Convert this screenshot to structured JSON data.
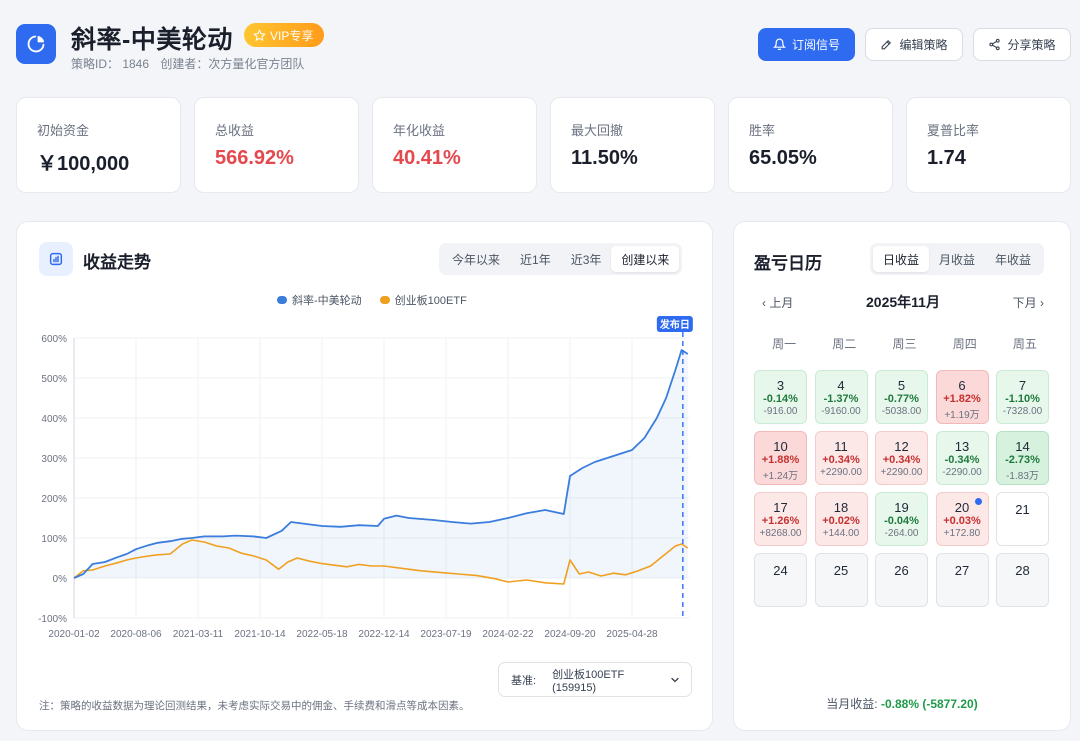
{
  "header": {
    "title": "斜率-中美轮动",
    "vip_label": "VIP专享",
    "strategy_id": "策略ID： 1846",
    "creator": "创建者：次方量化官方团队",
    "subscribe_label": "订阅信号",
    "edit_label": "编辑策略",
    "share_label": "分享策略"
  },
  "stats": [
    {
      "label": "初始资金",
      "value": "￥100,000",
      "color": "#1a1f2b"
    },
    {
      "label": "总收益",
      "value": "566.92%",
      "color": "#e5484d"
    },
    {
      "label": "年化收益",
      "value": "40.41%",
      "color": "#e5484d"
    },
    {
      "label": "最大回撤",
      "value": "11.50%",
      "color": "#1a1f2b"
    },
    {
      "label": "胜率",
      "value": "65.05%",
      "color": "#1a1f2b"
    },
    {
      "label": "夏普比率",
      "value": "1.74",
      "color": "#1a1f2b"
    }
  ],
  "chart_panel": {
    "title": "收益走势",
    "ranges": [
      "今年以来",
      "近1年",
      "近3年",
      "创建以来"
    ],
    "active_range": "创建以来",
    "benchmark_label": "基准:",
    "benchmark_value": "创业板100ETF (159915)",
    "note": "注：策略的收益数据为理论回测结果，未考虑实际交易中的佣金、手续费和滑点等成本因素。",
    "publish_marker": "发布日"
  },
  "chart_data": {
    "type": "line",
    "title": "",
    "xlabel": "",
    "ylabel": "",
    "ylim": [
      -100,
      600
    ],
    "yticks": [
      "600%",
      "500%",
      "400%",
      "300%",
      "200%",
      "100%",
      "0%",
      "-100%"
    ],
    "xticks": [
      "2020-01-02",
      "2020-08-06",
      "2021-03-11",
      "2021-10-14",
      "2022-05-18",
      "2022-12-14",
      "2023-07-19",
      "2024-02-22",
      "2024-09-20",
      "2025-04-28"
    ],
    "legend_position": "top-center",
    "series": [
      {
        "name": "斜率-中美轮动",
        "color": "#3b7ddd",
        "points": [
          [
            0,
            0
          ],
          [
            0.15,
            10
          ],
          [
            0.3,
            35
          ],
          [
            0.5,
            40
          ],
          [
            0.7,
            52
          ],
          [
            0.85,
            60
          ],
          [
            1.0,
            72
          ],
          [
            1.2,
            82
          ],
          [
            1.35,
            88
          ],
          [
            1.55,
            92
          ],
          [
            1.75,
            98
          ],
          [
            1.9,
            100
          ],
          [
            2.1,
            104
          ],
          [
            2.4,
            104
          ],
          [
            2.6,
            106
          ],
          [
            2.9,
            104
          ],
          [
            3.1,
            100
          ],
          [
            3.35,
            118
          ],
          [
            3.5,
            140
          ],
          [
            3.7,
            136
          ],
          [
            4.0,
            130
          ],
          [
            4.3,
            128
          ],
          [
            4.6,
            132
          ],
          [
            4.9,
            130
          ],
          [
            5.0,
            148
          ],
          [
            5.2,
            156
          ],
          [
            5.4,
            150
          ],
          [
            5.8,
            145
          ],
          [
            6.1,
            140
          ],
          [
            6.4,
            136
          ],
          [
            6.7,
            140
          ],
          [
            7.0,
            150
          ],
          [
            7.3,
            162
          ],
          [
            7.6,
            170
          ],
          [
            7.9,
            160
          ],
          [
            8.0,
            255
          ],
          [
            8.2,
            275
          ],
          [
            8.4,
            290
          ],
          [
            8.6,
            300
          ],
          [
            8.8,
            310
          ],
          [
            9.0,
            320
          ],
          [
            9.2,
            350
          ],
          [
            9.4,
            400
          ],
          [
            9.55,
            450
          ],
          [
            9.7,
            520
          ],
          [
            9.8,
            570
          ],
          [
            9.9,
            560
          ]
        ]
      },
      {
        "name": "创业板100ETF",
        "color": "#f0a020",
        "points": [
          [
            0,
            0
          ],
          [
            0.15,
            18
          ],
          [
            0.3,
            20
          ],
          [
            0.5,
            30
          ],
          [
            0.7,
            38
          ],
          [
            0.85,
            45
          ],
          [
            1.0,
            50
          ],
          [
            1.2,
            55
          ],
          [
            1.35,
            58
          ],
          [
            1.55,
            60
          ],
          [
            1.75,
            85
          ],
          [
            1.9,
            95
          ],
          [
            2.1,
            90
          ],
          [
            2.3,
            80
          ],
          [
            2.5,
            75
          ],
          [
            2.7,
            62
          ],
          [
            2.9,
            55
          ],
          [
            3.1,
            45
          ],
          [
            3.3,
            22
          ],
          [
            3.45,
            40
          ],
          [
            3.6,
            50
          ],
          [
            3.8,
            42
          ],
          [
            4.0,
            36
          ],
          [
            4.2,
            32
          ],
          [
            4.4,
            28
          ],
          [
            4.6,
            34
          ],
          [
            4.8,
            30
          ],
          [
            5.0,
            30
          ],
          [
            5.3,
            24
          ],
          [
            5.6,
            18
          ],
          [
            5.9,
            14
          ],
          [
            6.2,
            10
          ],
          [
            6.5,
            6
          ],
          [
            6.8,
            -2
          ],
          [
            7.0,
            -10
          ],
          [
            7.3,
            -5
          ],
          [
            7.6,
            -12
          ],
          [
            7.9,
            -15
          ],
          [
            8.0,
            45
          ],
          [
            8.15,
            10
          ],
          [
            8.3,
            15
          ],
          [
            8.5,
            5
          ],
          [
            8.7,
            12
          ],
          [
            8.9,
            8
          ],
          [
            9.1,
            18
          ],
          [
            9.3,
            30
          ],
          [
            9.5,
            55
          ],
          [
            9.7,
            80
          ],
          [
            9.8,
            85
          ],
          [
            9.9,
            75
          ]
        ]
      }
    ]
  },
  "calendar": {
    "title": "盈亏日历",
    "tabs": [
      "日收益",
      "月收益",
      "年收益"
    ],
    "active_tab": "日收益",
    "prev_label": "上月",
    "next_label": "下月",
    "month_label": "2025年11月",
    "weekdays": [
      "周一",
      "周二",
      "周三",
      "周四",
      "周五"
    ],
    "cells": [
      {
        "day": "3",
        "pct": "-0.14%",
        "amt": "-916.00",
        "state": "down"
      },
      {
        "day": "4",
        "pct": "-1.37%",
        "amt": "-9160.00",
        "state": "down"
      },
      {
        "day": "5",
        "pct": "-0.77%",
        "amt": "-5038.00",
        "state": "down"
      },
      {
        "day": "6",
        "pct": "+1.82%",
        "amt": "+1.19万",
        "state": "up-strong"
      },
      {
        "day": "7",
        "pct": "-1.10%",
        "amt": "-7328.00",
        "state": "down"
      },
      {
        "day": "10",
        "pct": "+1.88%",
        "amt": "+1.24万",
        "state": "up-strong"
      },
      {
        "day": "11",
        "pct": "+0.34%",
        "amt": "+2290.00",
        "state": "up"
      },
      {
        "day": "12",
        "pct": "+0.34%",
        "amt": "+2290.00",
        "state": "up"
      },
      {
        "day": "13",
        "pct": "-0.34%",
        "amt": "-2290.00",
        "state": "down"
      },
      {
        "day": "14",
        "pct": "-2.73%",
        "amt": "-1.83万",
        "state": "down-strong"
      },
      {
        "day": "17",
        "pct": "+1.26%",
        "amt": "+8268.00",
        "state": "up"
      },
      {
        "day": "18",
        "pct": "+0.02%",
        "amt": "+144.00",
        "state": "up"
      },
      {
        "day": "19",
        "pct": "-0.04%",
        "amt": "-264.00",
        "state": "down"
      },
      {
        "day": "20",
        "pct": "+0.03%",
        "amt": "+172.80",
        "state": "up"
      },
      {
        "day": "21",
        "pct": "",
        "amt": "",
        "state": "empty"
      },
      {
        "day": "24",
        "pct": "",
        "amt": "",
        "state": "future"
      },
      {
        "day": "25",
        "pct": "",
        "amt": "",
        "state": "future"
      },
      {
        "day": "26",
        "pct": "",
        "amt": "",
        "state": "future"
      },
      {
        "day": "27",
        "pct": "",
        "amt": "",
        "state": "future"
      },
      {
        "day": "28",
        "pct": "",
        "amt": "",
        "state": "future"
      }
    ],
    "month_total_label": "当月收益:",
    "month_total_value": "-0.88% (-5877.20)"
  }
}
